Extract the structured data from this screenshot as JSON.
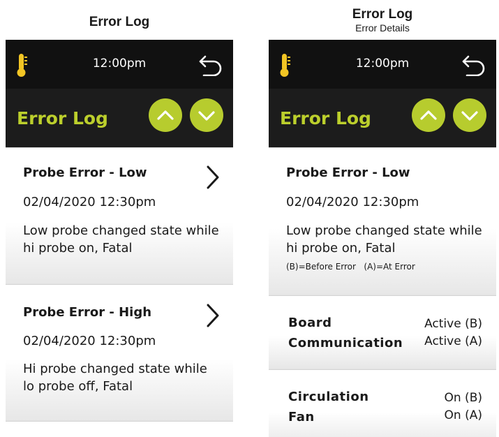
{
  "left_caption": {
    "title": "Error Log"
  },
  "right_caption": {
    "title": "Error Log",
    "subtitle": "Error Details"
  },
  "status_bar": {
    "time": "12:00pm"
  },
  "header": {
    "title": "Error Log"
  },
  "colors": {
    "accent": "#b7cc2e",
    "title_accent": "#bccf2c",
    "thermometer": "#f2c524",
    "dark": "#1b1b1b"
  },
  "icons": {
    "status_left": "thermometer-icon",
    "status_right": "back-arrow-icon",
    "nav_up": "chevron-up-icon",
    "nav_down": "chevron-down-icon",
    "row_action": "chevron-right-icon"
  },
  "error_list": [
    {
      "title": "Probe Error - Low",
      "date": "02/04/2020  12:30pm",
      "description": "Low probe changed state while hi probe on, Fatal"
    },
    {
      "title": "Probe Error - High",
      "date": "02/04/2020  12:30pm",
      "description": "Hi probe changed state while lo probe off, Fatal"
    }
  ],
  "error_detail": {
    "title": "Probe Error - Low",
    "date": "02/04/2020  12:30pm",
    "description": "Low probe changed state while hi probe on, Fatal",
    "legend": "(B)=Before Error   (A)=At Error",
    "items": [
      {
        "label_line1": "Board",
        "label_line2": "Communication",
        "value_before": "Active (B)",
        "value_at": "Active (A)"
      },
      {
        "label_line1": "Circulation",
        "label_line2": "Fan",
        "value_before": "On (B)",
        "value_at": "On (A)"
      }
    ]
  }
}
